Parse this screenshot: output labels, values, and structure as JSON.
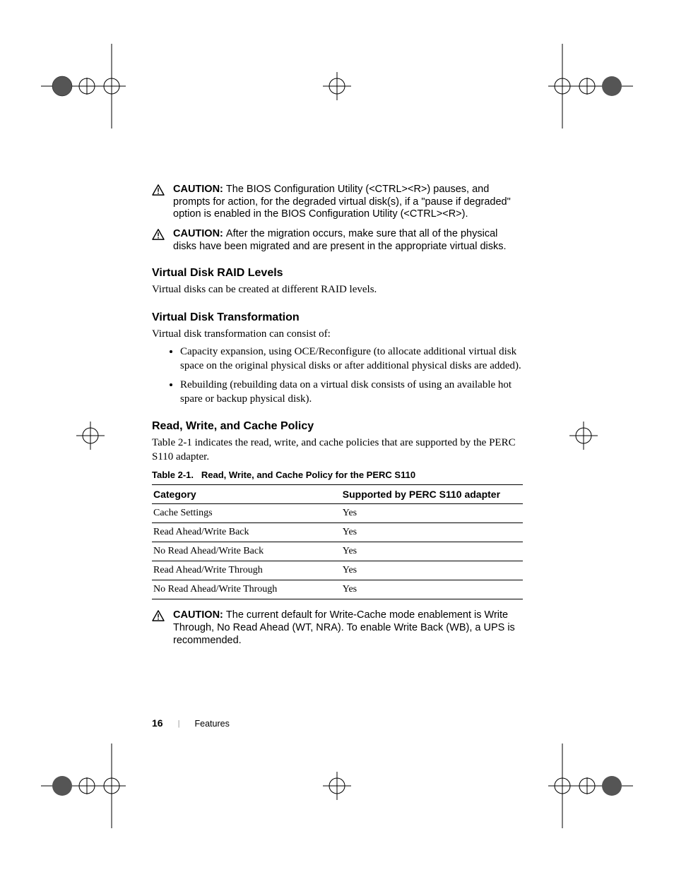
{
  "caution1": {
    "label": "CAUTION: ",
    "text": "The BIOS Configuration Utility (<CTRL><R>) pauses, and prompts for action, for the degraded virtual disk(s), if a \"pause if degraded\" option is enabled in the BIOS Configuration Utility (<CTRL><R>)."
  },
  "caution2": {
    "label": "CAUTION: ",
    "text": "After the migration occurs, make sure that all of the physical disks have been migrated and are present in the appropriate virtual disks."
  },
  "section1": {
    "heading": "Virtual Disk RAID Levels",
    "body": "Virtual disks can be created at different RAID levels."
  },
  "section2": {
    "heading": "Virtual Disk Transformation",
    "intro": "Virtual disk transformation can consist of:",
    "bullets": [
      "Capacity expansion, using OCE/Reconfigure (to allocate additional virtual disk space on the original physical disks or after additional physical disks are added).",
      "Rebuilding (rebuilding data on a virtual disk consists of using an available hot spare or backup physical disk)."
    ]
  },
  "section3": {
    "heading": "Read, Write, and Cache Policy",
    "body": "Table 2-1 indicates the read, write, and cache policies that are supported by the PERC S110 adapter.",
    "table_caption_prefix": "Table 2-1.",
    "table_caption": "Read, Write, and Cache Policy for the PERC S110",
    "columns": [
      "Category",
      "Supported by PERC S110 adapter"
    ],
    "rows": [
      [
        "Cache Settings",
        "Yes"
      ],
      [
        "Read Ahead/Write Back",
        "Yes"
      ],
      [
        "No Read Ahead/Write Back",
        "Yes"
      ],
      [
        "Read Ahead/Write Through",
        "Yes"
      ],
      [
        "No Read Ahead/Write Through",
        "Yes"
      ]
    ]
  },
  "caution3": {
    "label": "CAUTION: ",
    "text": "The current default for Write-Cache mode enablement is Write Through, No Read Ahead (WT, NRA). To enable Write Back (WB), a UPS is recommended."
  },
  "footer": {
    "page_number": "16",
    "section_name": "Features"
  }
}
